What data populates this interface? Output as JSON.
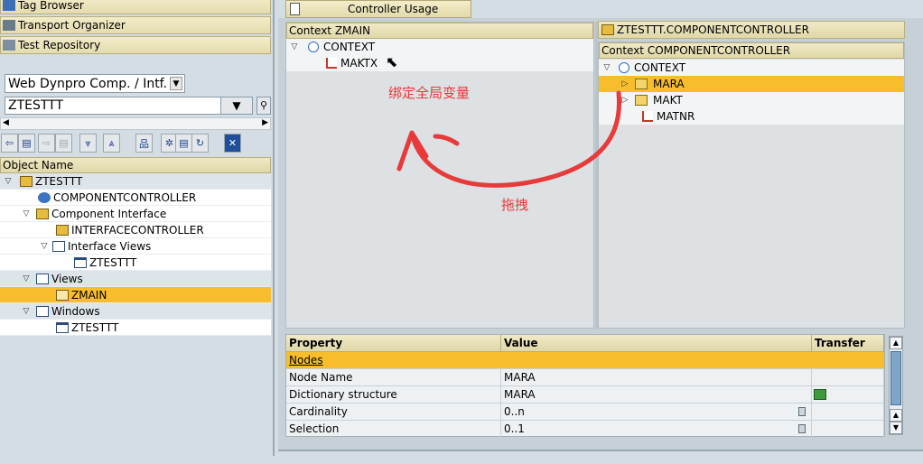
{
  "nav": {
    "tag_browser": "Tag Browser",
    "transport_organizer": "Transport Organizer",
    "test_repository": "Test Repository"
  },
  "object_type_select": "Web Dynpro Comp. / Intf.",
  "object_name_input": "ZTESTTT",
  "object_list_header": "Object Name",
  "tree": {
    "root": "ZTESTTT",
    "component_controller": "COMPONENTCONTROLLER",
    "component_interface": "Component Interface",
    "interface_controller": "INTERFACECONTROLLER",
    "interface_views": "Interface Views",
    "interface_view_item": "ZTESTTT",
    "views": "Views",
    "view_item": "ZMAIN",
    "windows": "Windows",
    "window_item": "ZTESTTT"
  },
  "tab_controller_usage": "Controller Usage",
  "left_context": {
    "header": "Context ZMAIN",
    "root": "CONTEXT",
    "attribute": "MAKTX"
  },
  "right_controller": {
    "title": "ZTESTTT.COMPONENTCONTROLLER",
    "header": "Context COMPONENTCONTROLLER",
    "root": "CONTEXT",
    "nodes": [
      "MARA",
      "MAKT"
    ],
    "attribute": "MATNR"
  },
  "annotations": {
    "bind_global": "绑定全局变量",
    "drag": "拖拽"
  },
  "properties": {
    "columns": [
      "Property",
      "Value",
      "Transfer at..."
    ],
    "section": "Nodes",
    "rows": [
      {
        "property": "Node Name",
        "value": "MARA"
      },
      {
        "property": "Dictionary structure",
        "value": "MARA"
      },
      {
        "property": "Cardinality",
        "value": "0..n"
      },
      {
        "property": "Selection",
        "value": "0..1"
      }
    ]
  },
  "colors": {
    "selection": "#f7bd2c",
    "annotation": "#e83a3a",
    "header": "#e0d8a8"
  }
}
